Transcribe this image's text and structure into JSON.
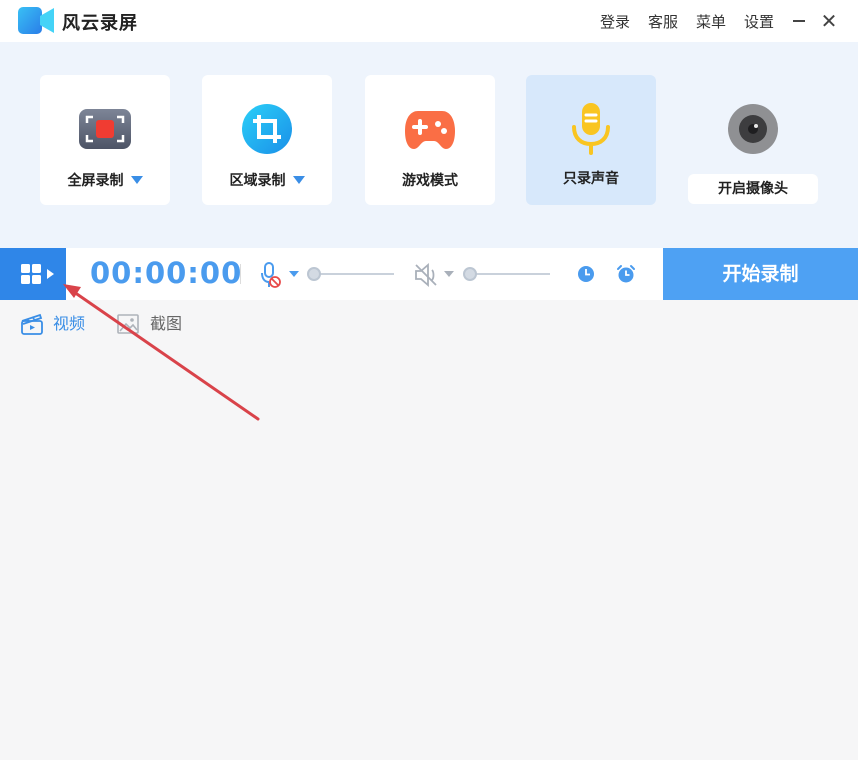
{
  "app": {
    "title": "风云录屏"
  },
  "top_links": [
    "登录",
    "客服",
    "菜单",
    "设置"
  ],
  "window_controls": {
    "close": "✕"
  },
  "modes": [
    {
      "label": "全屏录制",
      "icon": "fullscreen-record-icon",
      "has_dropdown": true
    },
    {
      "label": "区域录制",
      "icon": "crop-area-icon",
      "has_dropdown": true
    },
    {
      "label": "游戏模式",
      "icon": "gamepad-icon",
      "has_dropdown": false
    },
    {
      "label": "只录声音",
      "icon": "microphone-icon",
      "has_dropdown": false,
      "selected": true
    }
  ],
  "camera": {
    "label": "开启摄像头",
    "icon": "webcam-icon"
  },
  "control_bar": {
    "timer": "00:00:00",
    "start_label": "开始录制"
  },
  "tabs": [
    {
      "label": "视频",
      "icon": "video-clapper-icon",
      "active": true
    },
    {
      "label": "截图",
      "icon": "image-icon",
      "active": false
    }
  ],
  "colors": {
    "accent": "#2f86e8",
    "start_button": "#4ea1f3",
    "timer": "#4a9bee",
    "mode_bg": "#eef4fc",
    "selected_card": "#d7e8fb",
    "annotation_arrow": "#d9434a"
  }
}
